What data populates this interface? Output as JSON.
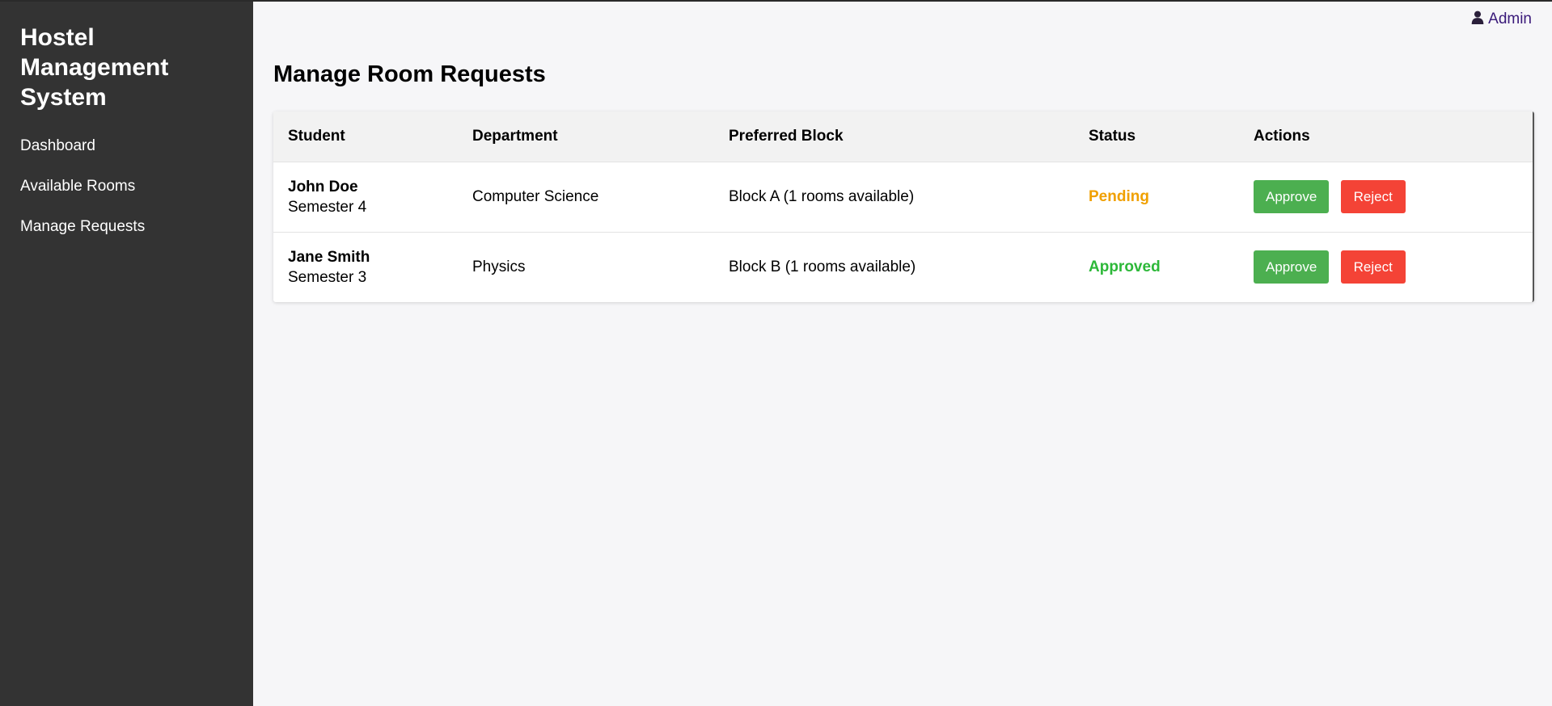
{
  "sidebar": {
    "brand": "Hostel Management System",
    "items": [
      {
        "label": "Dashboard"
      },
      {
        "label": "Available Rooms"
      },
      {
        "label": "Manage Requests"
      }
    ]
  },
  "header": {
    "user_label": "Admin",
    "user_icon": "user-icon"
  },
  "main": {
    "title": "Manage Room Requests",
    "columns": [
      "Student",
      "Department",
      "Preferred Block",
      "Status",
      "Actions"
    ],
    "rows": [
      {
        "name": "John Doe",
        "semester": "Semester 4",
        "department": "Computer Science",
        "block": "Block A (1 rooms available)",
        "status": "Pending",
        "status_color": "#f0a000",
        "approve": "Approve",
        "reject": "Reject"
      },
      {
        "name": "Jane Smith",
        "semester": "Semester 3",
        "department": "Physics",
        "block": "Block B (1 rooms available)",
        "status": "Approved",
        "status_color": "#2db839",
        "approve": "Approve",
        "reject": "Reject"
      }
    ]
  },
  "colors": {
    "sidebar_bg": "#333333",
    "approve_bg": "#4caf50",
    "reject_bg": "#f44336",
    "admin_link": "#3a1a7a"
  }
}
